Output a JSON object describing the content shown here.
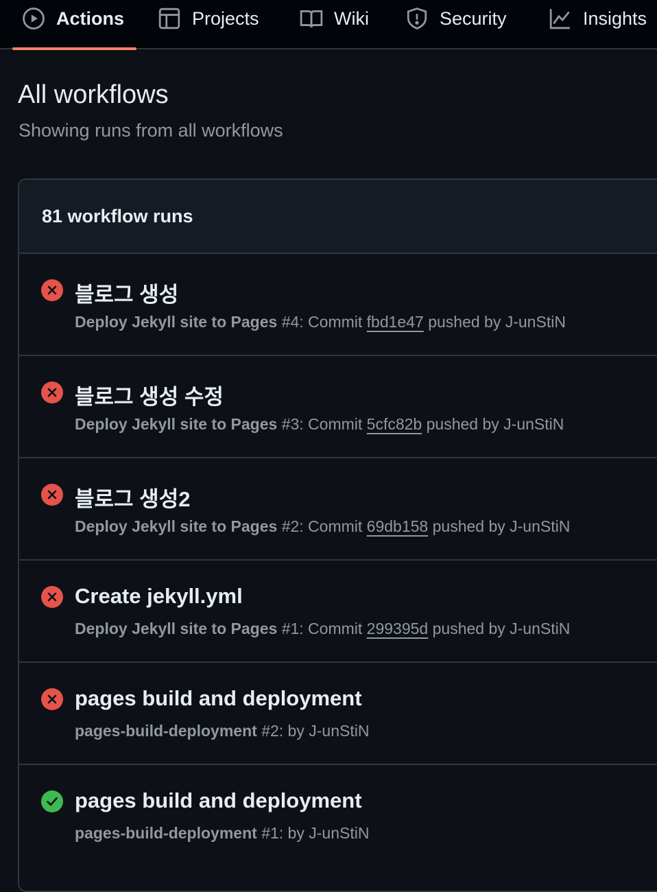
{
  "nav": {
    "tabs": [
      {
        "label": "Actions",
        "icon": "play-icon",
        "active": true
      },
      {
        "label": "Projects",
        "icon": "table-icon",
        "active": false
      },
      {
        "label": "Wiki",
        "icon": "book-icon",
        "active": false
      },
      {
        "label": "Security",
        "icon": "shield-icon",
        "active": false
      },
      {
        "label": "Insights",
        "icon": "graph-icon",
        "active": false
      }
    ]
  },
  "page": {
    "title": "All workflows",
    "subtitle": "Showing runs from all workflows"
  },
  "runs": {
    "count_label": "81 workflow runs",
    "items": [
      {
        "status": "failure",
        "title": "블로그 생성",
        "workflow": "Deploy Jekyll site to Pages",
        "run_number": "#4",
        "commit_prefix": ": Commit ",
        "sha": "fbd1e47",
        "by_text": " pushed by J-unStiN"
      },
      {
        "status": "failure",
        "title": "블로그 생성 수정",
        "workflow": "Deploy Jekyll site to Pages",
        "run_number": "#3",
        "commit_prefix": ": Commit ",
        "sha": "5cfc82b",
        "by_text": " pushed by J-unStiN"
      },
      {
        "status": "failure",
        "title": "블로그 생성2",
        "workflow": "Deploy Jekyll site to Pages",
        "run_number": "#2",
        "commit_prefix": ": Commit ",
        "sha": "69db158",
        "by_text": " pushed by J-unStiN"
      },
      {
        "status": "failure",
        "title": "Create jekyll.yml",
        "workflow": "Deploy Jekyll site to Pages",
        "run_number": "#1",
        "commit_prefix": ": Commit ",
        "sha": "299395d",
        "by_text": " pushed by J-unStiN"
      },
      {
        "status": "failure",
        "title": "pages build and deployment",
        "workflow": "pages-build-deployment",
        "run_number": "#2",
        "commit_prefix": ": by J-unStiN",
        "sha": "",
        "by_text": ""
      },
      {
        "status": "success",
        "title": "pages build and deployment",
        "workflow": "pages-build-deployment",
        "run_number": "#1",
        "commit_prefix": ": by J-unStiN",
        "sha": "",
        "by_text": ""
      }
    ]
  },
  "colors": {
    "failure": "#da3633",
    "success": "#238636",
    "accent_underline": "#f78166"
  }
}
